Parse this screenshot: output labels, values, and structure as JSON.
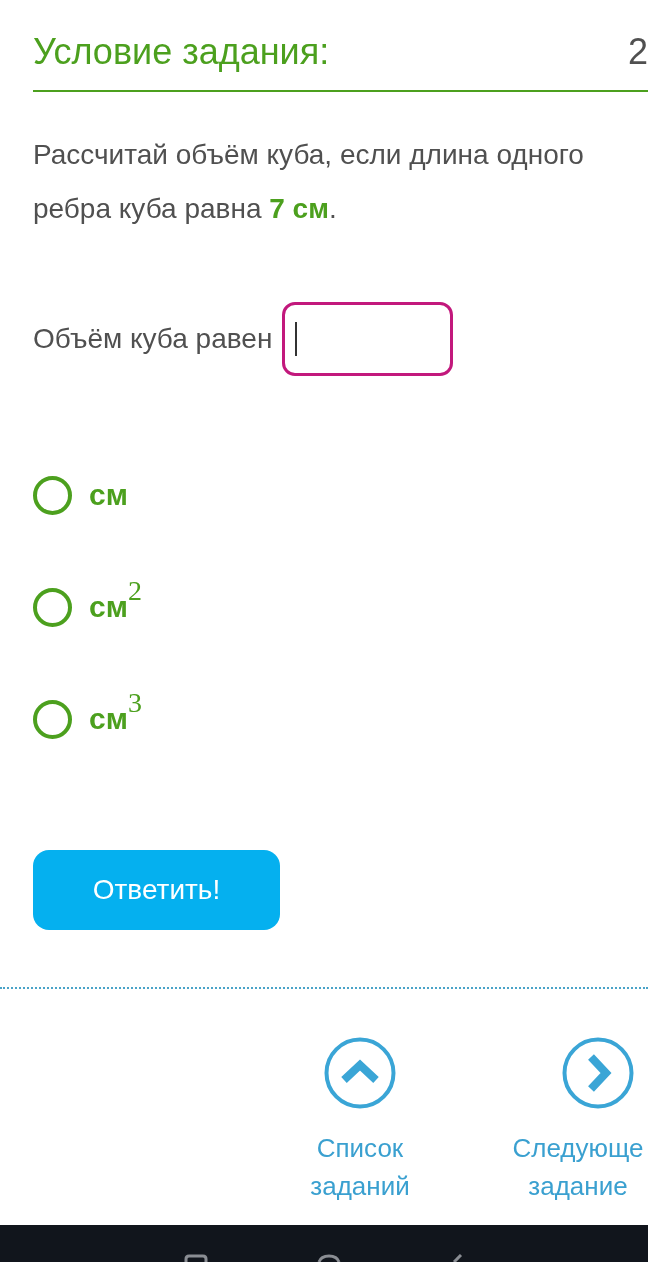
{
  "header": {
    "title": "Условие задания:",
    "counter": "2"
  },
  "task": {
    "text": "Рассчитай объём куба, если длина одного ребра куба равна **7 см**."
  },
  "answer": {
    "label": "Объём куба равен",
    "focused": true
  },
  "options": [
    {
      "label": "см",
      "selected": false
    },
    {
      "label": "см$^{2}$",
      "selected": false
    },
    {
      "label": "см$^{3}$",
      "selected": false
    }
  ],
  "submit_button": {
    "label": "Ответить!"
  },
  "nav_links": [
    {
      "kind": "up",
      "label": "Список заданий"
    },
    {
      "kind": "next",
      "label": "Следующе задание"
    }
  ]
}
